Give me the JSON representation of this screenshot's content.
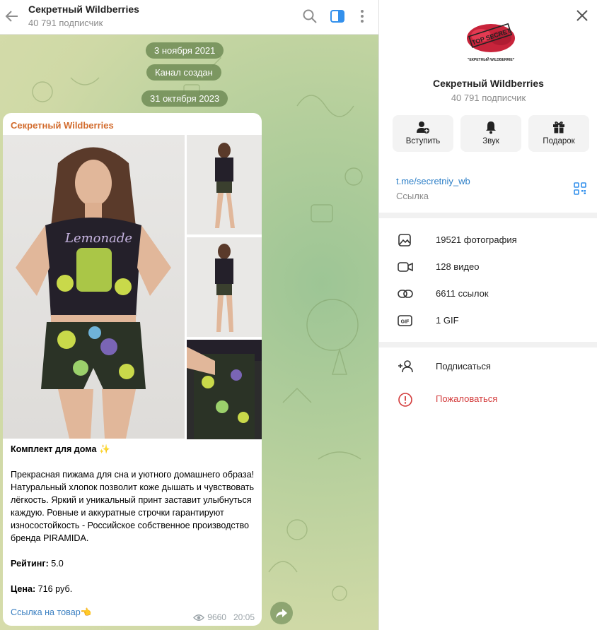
{
  "header": {
    "title": "Секретный Wildberries",
    "subscribers": "40 791 подписчик"
  },
  "chat": {
    "service_messages": [
      "3 ноября 2021",
      "Канал создан",
      "31 октября 2023"
    ],
    "message": {
      "author": "Секретный Wildberries",
      "shirt_print": "Lemonade",
      "title": "Комплект для дома ✨",
      "body": "Прекрасная пижама для сна и уютного домашнего образа! Натуральный хлопок позволит коже дышать и чувствовать лёгкость. Яркий и уникальный принт заставит улыбнуться каждую. Ровные и аккуратные строчки гарантируют износостойкость - Российское собственное производство бренда PIRAMIDA.",
      "rating_label": "Рейтинг:",
      "rating_value": "5.0",
      "price_label": "Цена:",
      "price_value": "716 руб.",
      "link_text": "Ссылка на товар👈",
      "views": "9660",
      "time": "20:05"
    }
  },
  "panel": {
    "avatar_text_top": "TOP SECRET",
    "avatar_text_bottom": "СЕКРЕТНЫЙ WILDBERRIES",
    "title": "Секретный Wildberries",
    "subscribers": "40 791 подписчик",
    "actions": [
      "Вступить",
      "Звук",
      "Подарок"
    ],
    "link": "t.me/secretniy_wb",
    "link_caption": "Ссылка",
    "media": [
      {
        "icon": "photo-icon",
        "label": "19521 фотография"
      },
      {
        "icon": "video-icon",
        "label": "128 видео"
      },
      {
        "icon": "link-icon",
        "label": "6611 ссылок"
      },
      {
        "icon": "gif-icon",
        "label": "1 GIF"
      }
    ],
    "subscribe": "Подписаться",
    "report": "Пожаловаться"
  },
  "colors": {
    "accent": "#3390ec",
    "author": "#d26c2e",
    "danger": "#d33b3b",
    "pill": "#708c56"
  }
}
